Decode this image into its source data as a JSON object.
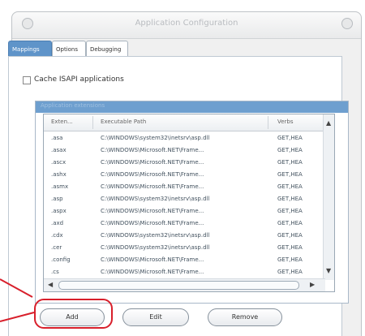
{
  "window": {
    "title": "Application Configuration"
  },
  "tabs": [
    {
      "label": "Mappings",
      "active": true
    },
    {
      "label": "Options",
      "active": false
    },
    {
      "label": "Debugging",
      "active": false
    }
  ],
  "cache": {
    "label": "Cache ISAPI applications",
    "checked": false
  },
  "group": {
    "label": "Application extensions"
  },
  "table": {
    "columns": [
      "Exten...",
      "Executable Path",
      "Verbs"
    ],
    "rows": [
      [
        ".asa",
        "C:\\WINDOWS\\system32\\inetsrv\\asp.dll",
        "GET,HEA"
      ],
      [
        ".asax",
        "C:\\WINDOWS\\Microsoft.NET\\Frame...",
        "GET,HEA"
      ],
      [
        ".ascx",
        "C:\\WINDOWS\\Microsoft.NET\\Frame...",
        "GET,HEA"
      ],
      [
        ".ashx",
        "C:\\WINDOWS\\Microsoft.NET\\Frame...",
        "GET,HEA"
      ],
      [
        ".asmx",
        "C:\\WINDOWS\\Microsoft.NET\\Frame...",
        "GET,HEA"
      ],
      [
        ".asp",
        "C:\\WINDOWS\\system32\\inetsrv\\asp.dll",
        "GET,HEA"
      ],
      [
        ".aspx",
        "C:\\WINDOWS\\Microsoft.NET\\Frame...",
        "GET,HEA"
      ],
      [
        ".axd",
        "C:\\WINDOWS\\Microsoft.NET\\Frame...",
        "GET,HEA"
      ],
      [
        ".cdx",
        "C:\\WINDOWS\\system32\\inetsrv\\asp.dll",
        "GET,HEA"
      ],
      [
        ".cer",
        "C:\\WINDOWS\\system32\\inetsrv\\asp.dll",
        "GET,HEA"
      ],
      [
        ".config",
        "C:\\WINDOWS\\Microsoft.NET\\Frame...",
        "GET,HEA"
      ],
      [
        ".cs",
        "C:\\WINDOWS\\Microsoft.NET\\Frame...",
        "GET,HEA"
      ]
    ]
  },
  "buttons": {
    "add": "Add",
    "edit": "Edit",
    "remove": "Remove"
  },
  "colors": {
    "highlight": "#d81f2b",
    "tab_active": "#5f94c9",
    "group_header": "#6e9fcf"
  }
}
